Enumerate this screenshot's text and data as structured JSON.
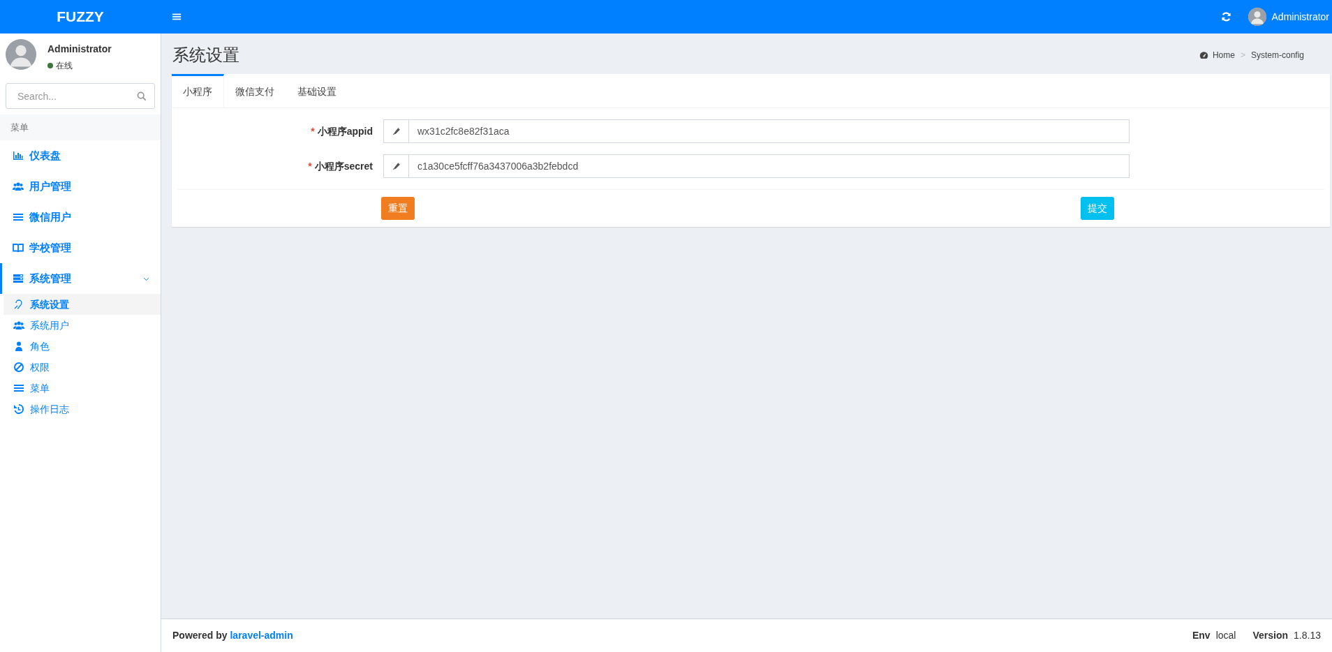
{
  "header": {
    "logo": "FUZZY",
    "user_name": "Administrator"
  },
  "sidebar": {
    "user": {
      "name": "Administrator",
      "status": "在线"
    },
    "search": {
      "placeholder": "Search..."
    },
    "menu_header": "菜单",
    "items": [
      {
        "label": "仪表盘",
        "selected": false
      },
      {
        "label": "用户管理",
        "selected": false
      },
      {
        "label": "微信用户",
        "selected": false
      },
      {
        "label": "学校管理",
        "selected": false
      },
      {
        "label": "系统管理",
        "selected": true,
        "expanded": true,
        "children": [
          {
            "label": "系统设置",
            "selected": true
          },
          {
            "label": "系统用户",
            "selected": false
          },
          {
            "label": "角色",
            "selected": false
          },
          {
            "label": "权限",
            "selected": false
          },
          {
            "label": "菜单",
            "selected": false
          },
          {
            "label": "操作日志",
            "selected": false
          }
        ]
      }
    ]
  },
  "page": {
    "title": "系统设置",
    "breadcrumb": [
      "Home",
      "System-config"
    ],
    "breadcrumb_separator": ">"
  },
  "tabs": [
    {
      "label": "小程序",
      "selected": true
    },
    {
      "label": "微信支付",
      "selected": false
    },
    {
      "label": "基础设置",
      "selected": false
    }
  ],
  "fields": [
    {
      "label": "小程序appid",
      "required_mark": "*",
      "value": "wx31c2fc8e82f31aca"
    },
    {
      "label": "小程序secret",
      "required_mark": "*",
      "value": "c1a30ce5fcff76a3437006a3b2febdcd"
    }
  ],
  "buttons": [
    {
      "label": "重置",
      "kind": "reset"
    },
    {
      "label": "提交",
      "kind": "submit"
    }
  ],
  "footer": {
    "powered_by": "Powered by",
    "link": "laravel-admin",
    "env_label": "Env",
    "env": "local",
    "version_label": "Version",
    "version": "1.8.13"
  }
}
